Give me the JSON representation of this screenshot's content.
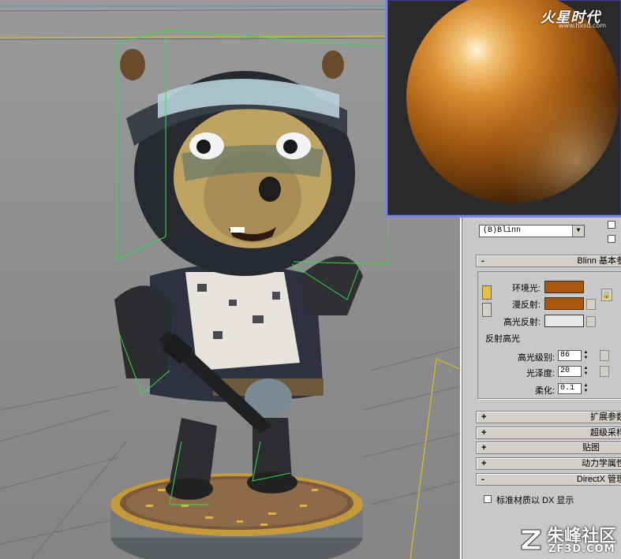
{
  "preview": {
    "watermark_brand": "火星时代",
    "watermark_url": "www.hxsd.com"
  },
  "panel": {
    "shader_type": "(B)Blinn",
    "rollouts": {
      "blinn_basic": "Blinn 基本参",
      "extended": "扩展参数",
      "supersampling": "超级采样",
      "maps": "贴图",
      "dynamics": "动力学属性",
      "directx": "DirectX 管理"
    },
    "labels": {
      "ambient": "环境光:",
      "diffuse": "漫反射:",
      "specular": "高光反射:",
      "specular_highlights": "反射高光",
      "specular_level": "高光级别:",
      "glossiness": "光泽度:",
      "soften": "柔化:",
      "dx_display": "标准材质以 DX 显示"
    },
    "values": {
      "specular_level": "86",
      "glossiness": "20",
      "soften": "0.1"
    },
    "colors": {
      "ambient": "#a8560c",
      "diffuse": "#a8560c",
      "specular": "#e8e8e8"
    }
  },
  "watermark": {
    "cn": "朱峰社区",
    "en": "ZF3D.COM"
  }
}
